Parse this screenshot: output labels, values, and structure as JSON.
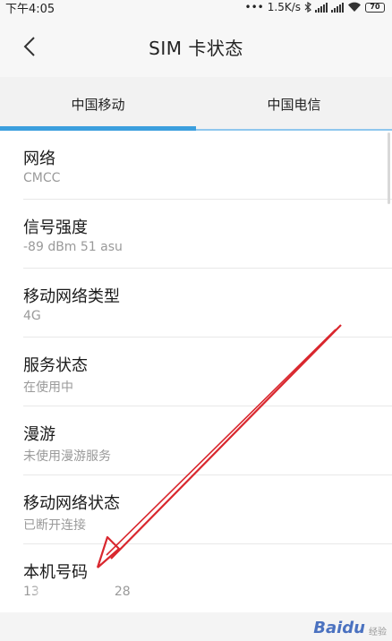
{
  "status_bar": {
    "time": "下午4:05",
    "network_speed": "1.5K/s",
    "battery_level": "70",
    "icons": [
      "more-dots-icon",
      "bluetooth-icon",
      "signal-icon",
      "signal-icon",
      "wifi-icon",
      "battery-icon"
    ]
  },
  "header": {
    "back_icon": "chevron-left-icon",
    "title": "SIM  卡状态"
  },
  "tabs": [
    {
      "label": "中国移动",
      "selected": true
    },
    {
      "label": "中国电信",
      "selected": false
    }
  ],
  "colors": {
    "accent": "#3c9fde",
    "annotation": "#d9272e"
  },
  "items": [
    {
      "title": "网络",
      "value": "CMCC"
    },
    {
      "title": "信号强度",
      "value": "-89 dBm 51 asu"
    },
    {
      "title": "移动网络类型",
      "value": "4G"
    },
    {
      "title": "服务状态",
      "value": "在使用中"
    },
    {
      "title": "漫游",
      "value": "未使用漫游服务"
    },
    {
      "title": "移动网络状态",
      "value": "已断开连接"
    },
    {
      "title": "本机号码",
      "value": "13      28"
    }
  ],
  "watermark": {
    "logo": "Baidu",
    "text": "经验"
  }
}
